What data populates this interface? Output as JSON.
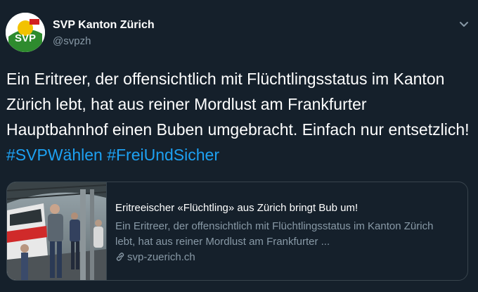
{
  "tweet": {
    "author_name": "SVP Kanton Zürich",
    "author_handle": "@svpzh",
    "avatar_text": "SVP",
    "text_plain": "Ein Eritreer, der offensichtlich mit Flüchtlingsstatus im Kanton Zürich lebt, hat aus reiner Mordlust am Frankfurter Hauptbahnhof einen Buben umgebracht. Einfach nur entsetzlich! ",
    "hashtags": [
      "#SVPWählen",
      "#FreiUndSicher"
    ]
  },
  "card": {
    "title": "Eritreeischer «Flüchtling» aus Zürich bringt Bub um!",
    "description": "Ein Eritreer, der offensichtlich mit Flüchtlingsstatus im Kanton Zürich lebt, hat aus reiner Mordlust am Frankfurter ...",
    "domain": "svp-zuerich.ch"
  },
  "colors": {
    "background": "#15202b",
    "text": "#ffffff",
    "secondary_text": "#8899a6",
    "hashtag": "#1da1f2",
    "border": "#38444d",
    "svp_green": "#2e8b2e",
    "svp_yellow": "#f2c200"
  },
  "icons": [
    "svp-logo",
    "chevron-down-icon",
    "link-icon"
  ]
}
